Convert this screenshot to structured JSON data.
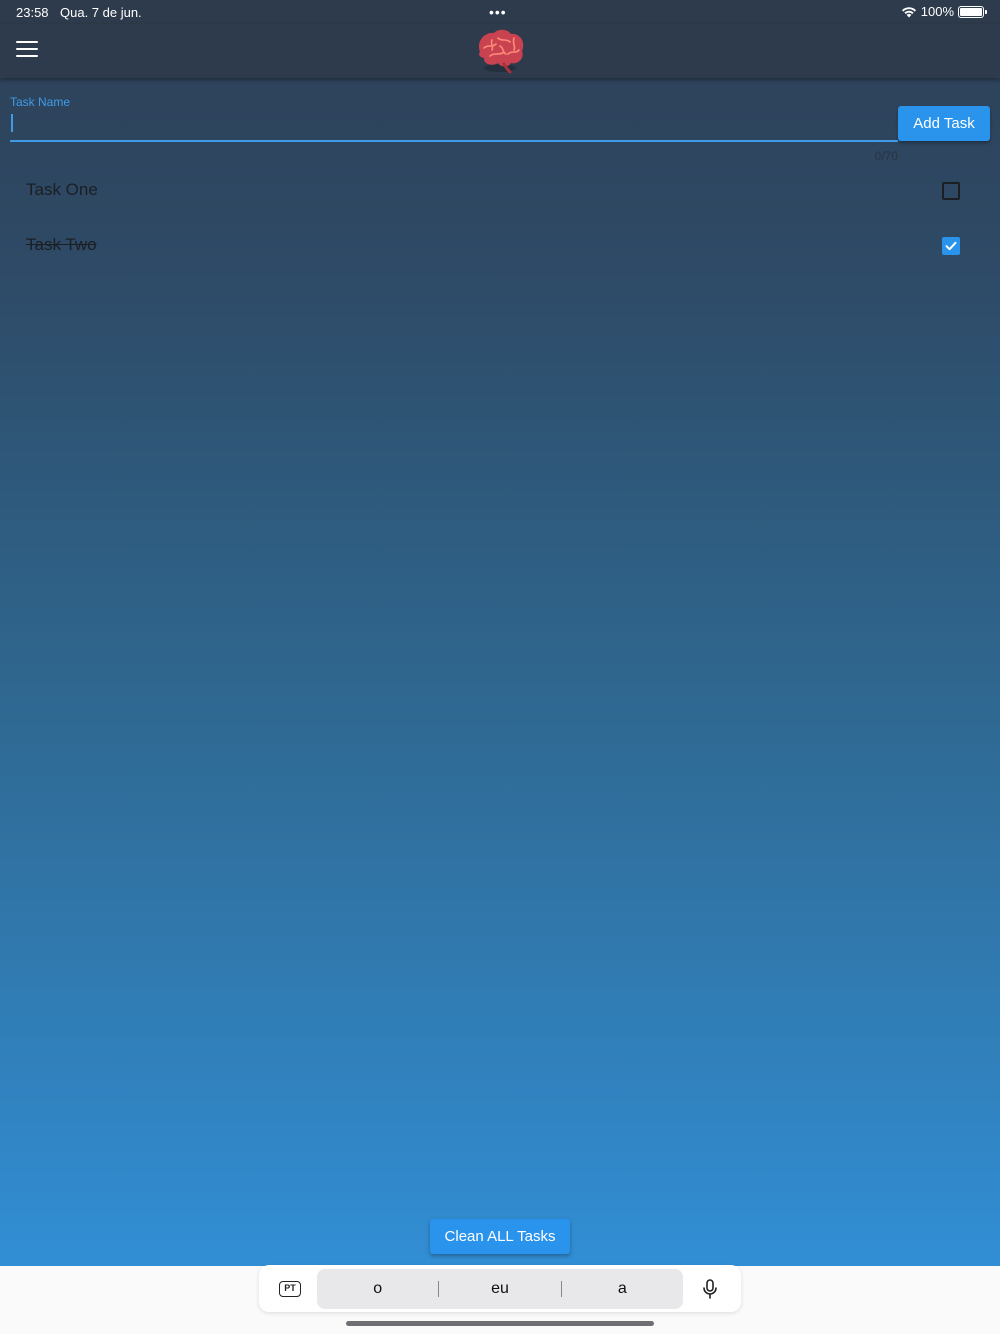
{
  "status_bar": {
    "time": "23:58",
    "date": "Qua. 7 de jun.",
    "battery": "100%"
  },
  "app_bar": {
    "logo_icon": "brain-icon",
    "menu_icon": "hamburger-menu-icon"
  },
  "task_input": {
    "label": "Task Name",
    "value": "",
    "counter": "0/70",
    "add_button": "Add Task"
  },
  "tasks": [
    {
      "label": "Task One",
      "done": false
    },
    {
      "label": "Task Two",
      "done": true
    }
  ],
  "clean_button": "Clean ALL Tasks",
  "keyboard": {
    "language": "PT",
    "suggestions": [
      "o",
      "eu",
      "a"
    ],
    "mic_icon": "microphone-icon"
  },
  "colors": {
    "accent": "#2a93ec",
    "app_bar": "#2e3b4c",
    "gradient_top": "#2e4057",
    "gradient_bottom": "#3293dd"
  }
}
